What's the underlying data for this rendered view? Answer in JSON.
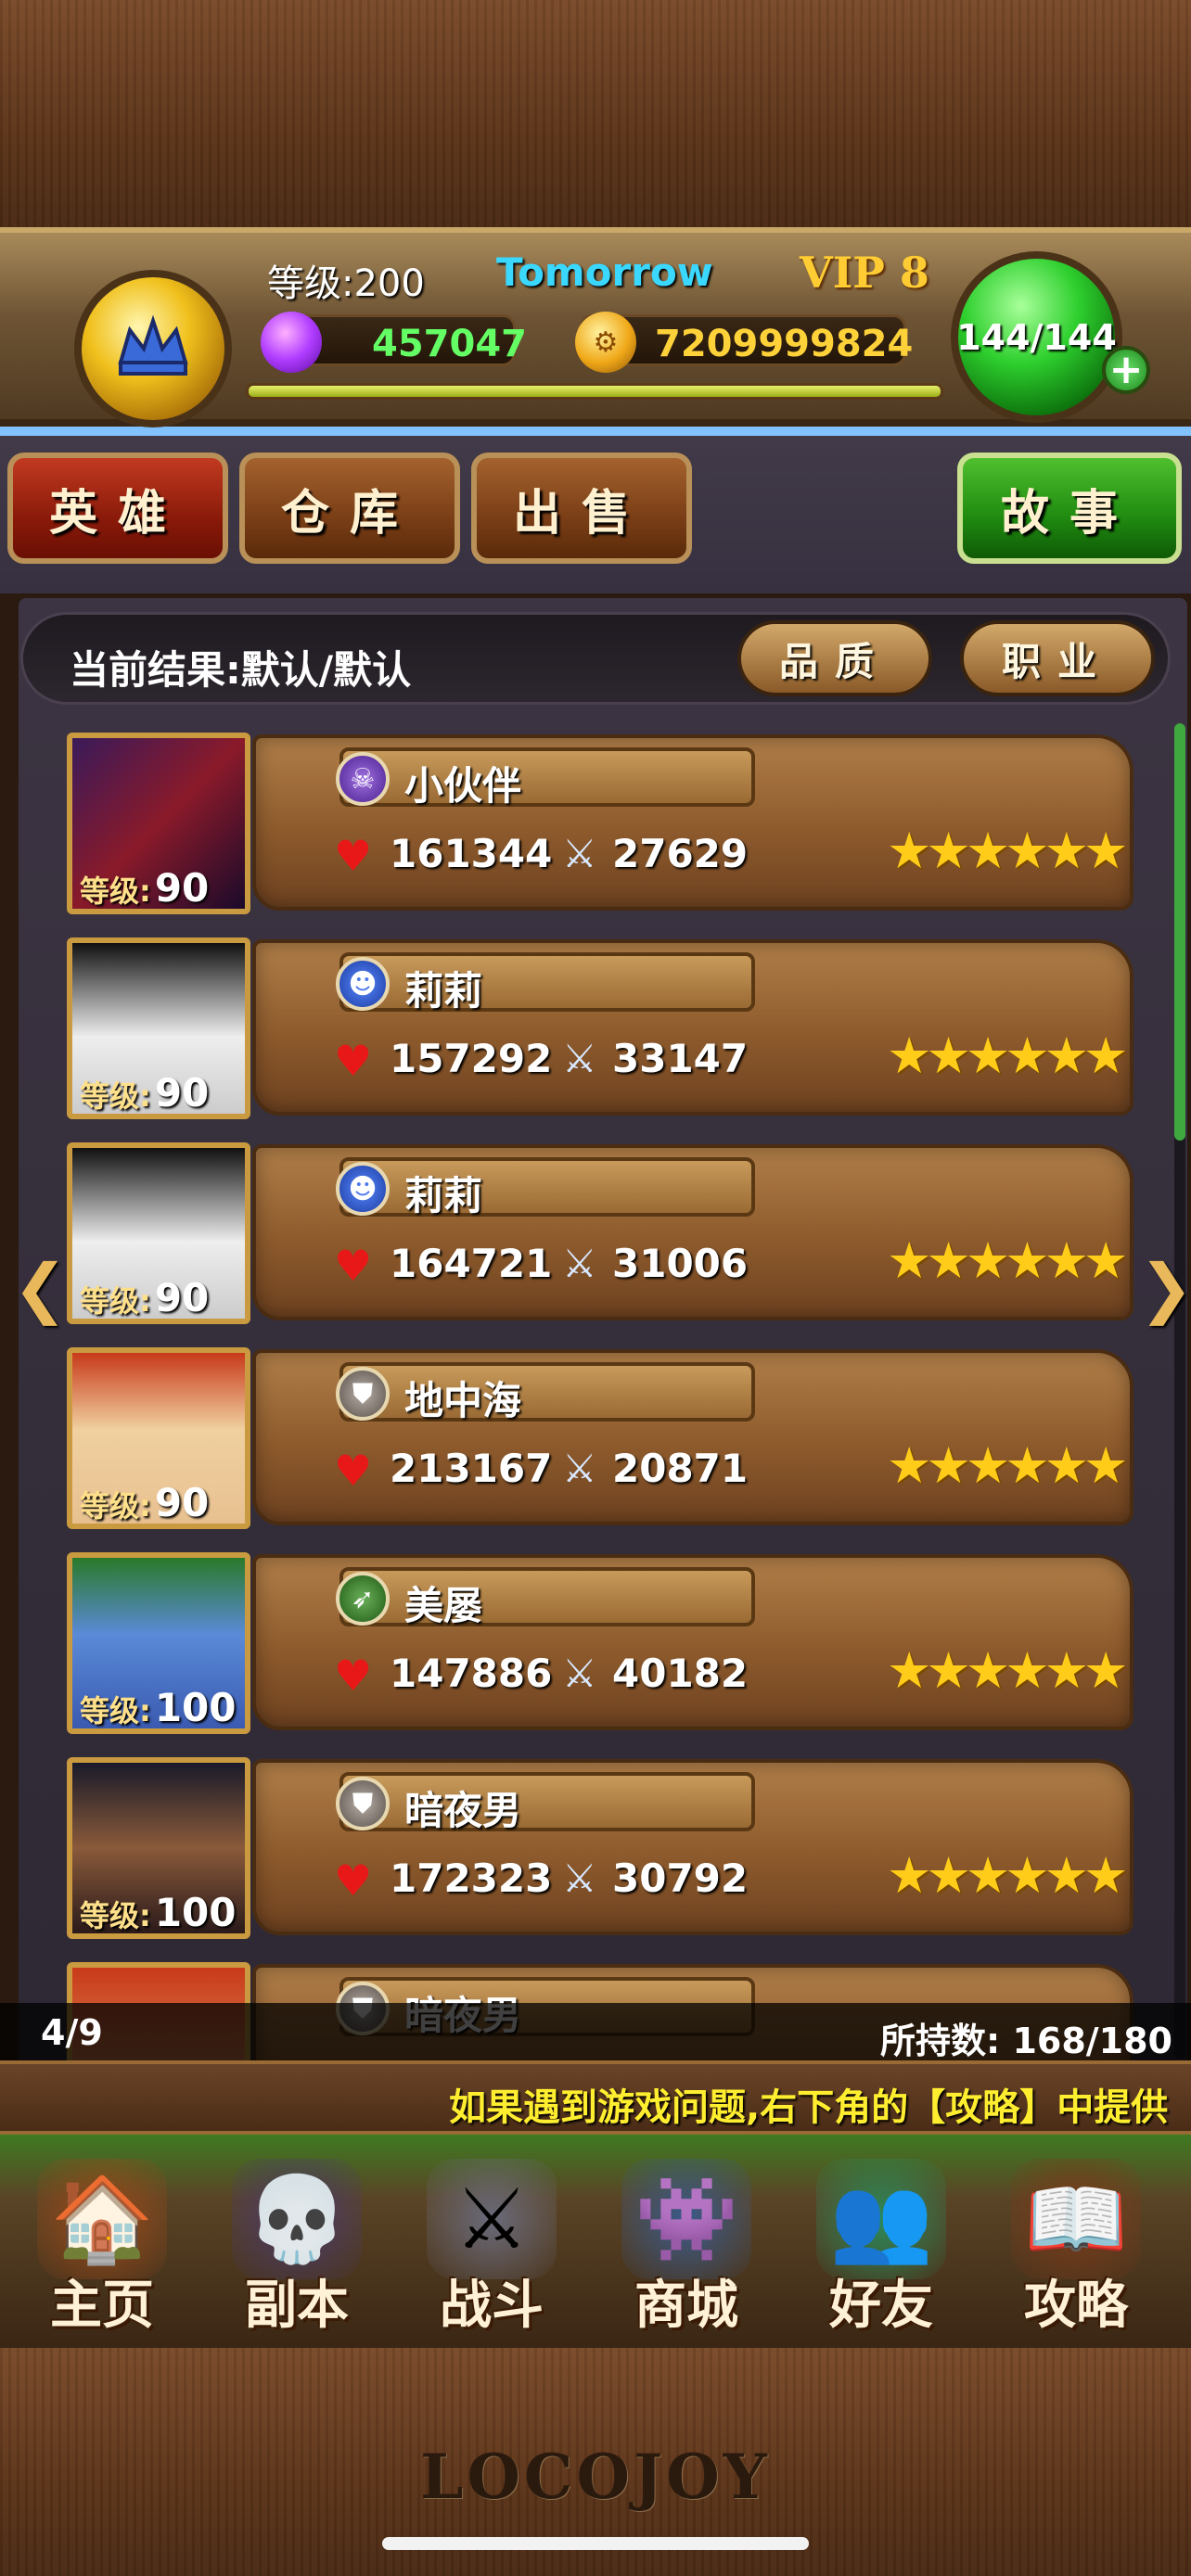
{
  "header": {
    "level": "等级:200",
    "player_name": "Tomorrow",
    "vip": "VIP 8",
    "gems": "457047",
    "coins": "7209999824",
    "energy": "144/144",
    "xp_fraction": 1.0
  },
  "tabs": [
    {
      "label": "英雄",
      "style": "red"
    },
    {
      "label": "仓库",
      "style": "brown"
    },
    {
      "label": "出售",
      "style": "brown"
    },
    {
      "label": "故事",
      "style": "green"
    }
  ],
  "filter": {
    "label": "当前结果:默认/默认",
    "quality_button": "品质",
    "job_button": "职业"
  },
  "heroes": [
    {
      "name": "小伙伴",
      "level_label": "等级:",
      "level": "90",
      "hp": "161344",
      "atk": "27629",
      "stars": 6,
      "class_icon": "skull-icon"
    },
    {
      "name": "莉莉",
      "level_label": "等级:",
      "level": "90",
      "hp": "157292",
      "atk": "33147",
      "stars": 6,
      "class_icon": "monkey-icon"
    },
    {
      "name": "莉莉",
      "level_label": "等级:",
      "level": "90",
      "hp": "164721",
      "atk": "31006",
      "stars": 6,
      "class_icon": "monkey-icon"
    },
    {
      "name": "地中海",
      "level_label": "等级:",
      "level": "90",
      "hp": "213167",
      "atk": "20871",
      "stars": 6,
      "class_icon": "shield-icon"
    },
    {
      "name": "美屡",
      "level_label": "等级:",
      "level": "100",
      "hp": "147886",
      "atk": "40182",
      "stars": 6,
      "class_icon": "bow-icon"
    },
    {
      "name": "暗夜男",
      "level_label": "等级:",
      "level": "100",
      "hp": "172323",
      "atk": "30792",
      "stars": 6,
      "class_icon": "shield-icon"
    },
    {
      "name": "暗夜男",
      "level_label": "",
      "level": "",
      "hp": "",
      "atk": "",
      "stars": 0,
      "class_icon": "shield-icon"
    }
  ],
  "pager": {
    "page": "4/9",
    "holding": "所持数: 168/180"
  },
  "ticker": "如果遇到游戏问题,右下角的【攻略】中提供",
  "nav": [
    {
      "label": "主页",
      "icon": "house-icon"
    },
    {
      "label": "副本",
      "icon": "skull-orb-icon"
    },
    {
      "label": "战斗",
      "icon": "sword-axe-icon"
    },
    {
      "label": "商城",
      "icon": "shop-monster-icon"
    },
    {
      "label": "好友",
      "icon": "friends-icon"
    },
    {
      "label": "攻略",
      "icon": "book-icon"
    }
  ],
  "footer": {
    "logo": "LOCOJOY"
  }
}
